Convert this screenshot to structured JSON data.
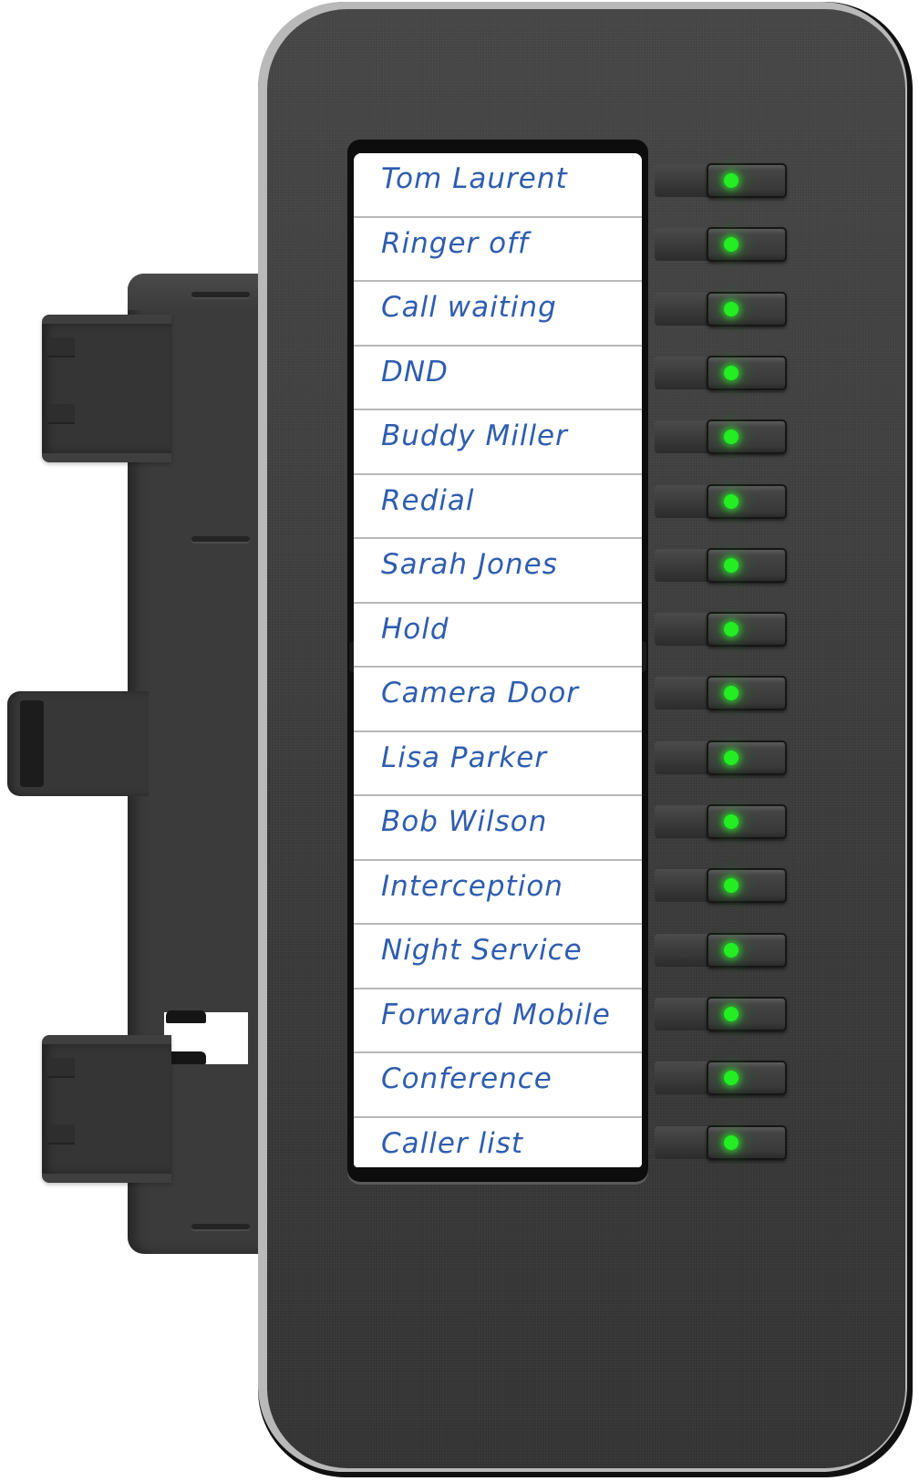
{
  "device": {
    "name": "Key module",
    "led_color": "#22ee22",
    "label_color": "#2f5db0"
  },
  "keys": [
    {
      "label": "Tom Laurent",
      "led": "on"
    },
    {
      "label": "Ringer off",
      "led": "on"
    },
    {
      "label": "Call waiting",
      "led": "on"
    },
    {
      "label": "DND",
      "led": "on"
    },
    {
      "label": "Buddy Miller",
      "led": "on"
    },
    {
      "label": "Redial",
      "led": "on"
    },
    {
      "label": "Sarah Jones",
      "led": "on"
    },
    {
      "label": "Hold",
      "led": "on"
    },
    {
      "label": "Camera Door",
      "led": "on"
    },
    {
      "label": "Lisa Parker",
      "led": "on"
    },
    {
      "label": "Bob Wilson",
      "led": "on"
    },
    {
      "label": "Interception",
      "led": "on"
    },
    {
      "label": "Night Service",
      "led": "on"
    },
    {
      "label": "Forward Mobile",
      "led": "on"
    },
    {
      "label": "Conference",
      "led": "on"
    },
    {
      "label": "Caller list",
      "led": "on"
    }
  ]
}
